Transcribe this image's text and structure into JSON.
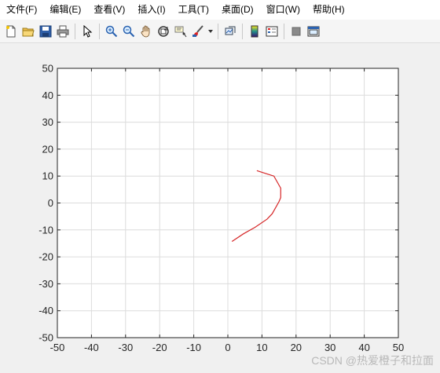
{
  "menubar": {
    "items": [
      {
        "label": "文件(F)"
      },
      {
        "label": "编辑(E)"
      },
      {
        "label": "查看(V)"
      },
      {
        "label": "插入(I)"
      },
      {
        "label": "工具(T)"
      },
      {
        "label": "桌面(D)"
      },
      {
        "label": "窗口(W)"
      },
      {
        "label": "帮助(H)"
      }
    ]
  },
  "toolbar": {
    "icons": [
      "new-file-icon",
      "open-folder-icon",
      "save-icon",
      "print-icon",
      "pointer-icon",
      "zoom-in-icon",
      "zoom-out-icon",
      "pan-hand-icon",
      "rotate-3d-icon",
      "data-cursor-icon",
      "brush-icon",
      "dropdown-arrow-icon",
      "link-plot-icon",
      "colorbar-icon",
      "legend-icon",
      "hide-plot-tools-icon",
      "show-plot-tools-icon"
    ]
  },
  "watermark": "CSDN @热爱橙子和拉面",
  "chart_data": {
    "type": "line",
    "title": "",
    "xlabel": "",
    "ylabel": "",
    "xlim": [
      -50,
      50
    ],
    "ylim": [
      -50,
      50
    ],
    "xticks": [
      -50,
      -40,
      -30,
      -20,
      -10,
      0,
      10,
      20,
      30,
      40,
      50
    ],
    "yticks": [
      -50,
      -40,
      -30,
      -20,
      -10,
      0,
      10,
      20,
      30,
      40,
      50
    ],
    "grid": true,
    "series": [
      {
        "color": "#d62728",
        "x": [
          1.2,
          4.5,
          8.0,
          11.5,
          13.0,
          15.0,
          15.5,
          15.5,
          13.5,
          11.0,
          8.5
        ],
        "y": [
          -14.3,
          -11.5,
          -9.0,
          -6.0,
          -4.0,
          0.5,
          2.0,
          5.5,
          10.0,
          11.0,
          12.0
        ]
      }
    ]
  },
  "colors": {
    "axes_bg": "#ffffff",
    "grid": "#dcdcdc",
    "figure_bg": "#f0f0f0"
  }
}
